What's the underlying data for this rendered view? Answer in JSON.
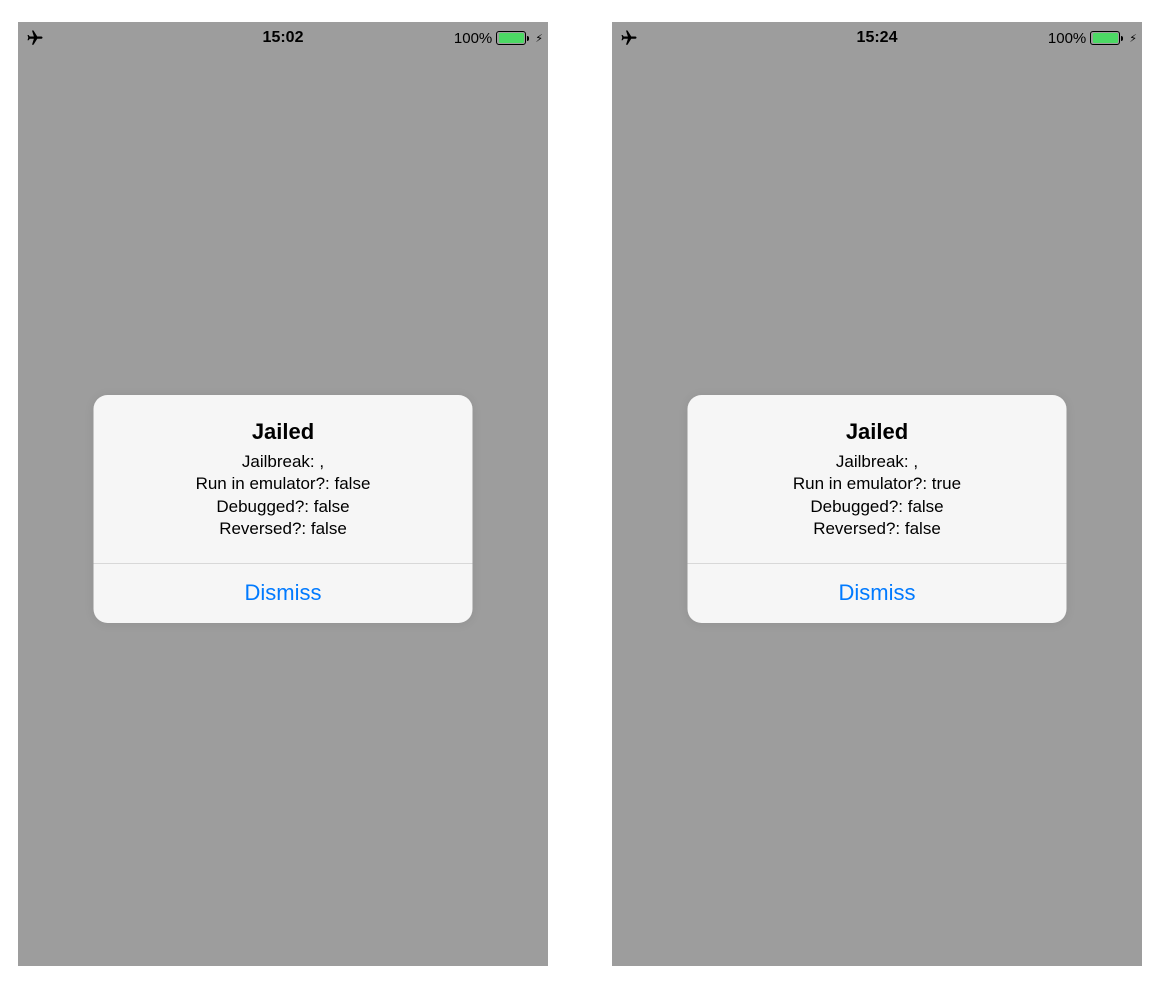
{
  "screens": [
    {
      "status": {
        "time": "15:02",
        "battery_pct": "100%"
      },
      "alert": {
        "title": "Jailed",
        "lines": [
          "Jailbreak: ,",
          "Run in emulator?: false",
          "Debugged?: false",
          "Reversed?: false"
        ],
        "dismiss_label": "Dismiss"
      }
    },
    {
      "status": {
        "time": "15:24",
        "battery_pct": "100%"
      },
      "alert": {
        "title": "Jailed",
        "lines": [
          "Jailbreak: ,",
          "Run in emulator?: true",
          "Debugged?: false",
          "Reversed?: false"
        ],
        "dismiss_label": "Dismiss"
      }
    }
  ],
  "colors": {
    "screen_bg": "#9d9d9d",
    "alert_bg": "#f8f8f8",
    "accent": "#007aff",
    "battery_fill": "#4cd964"
  }
}
